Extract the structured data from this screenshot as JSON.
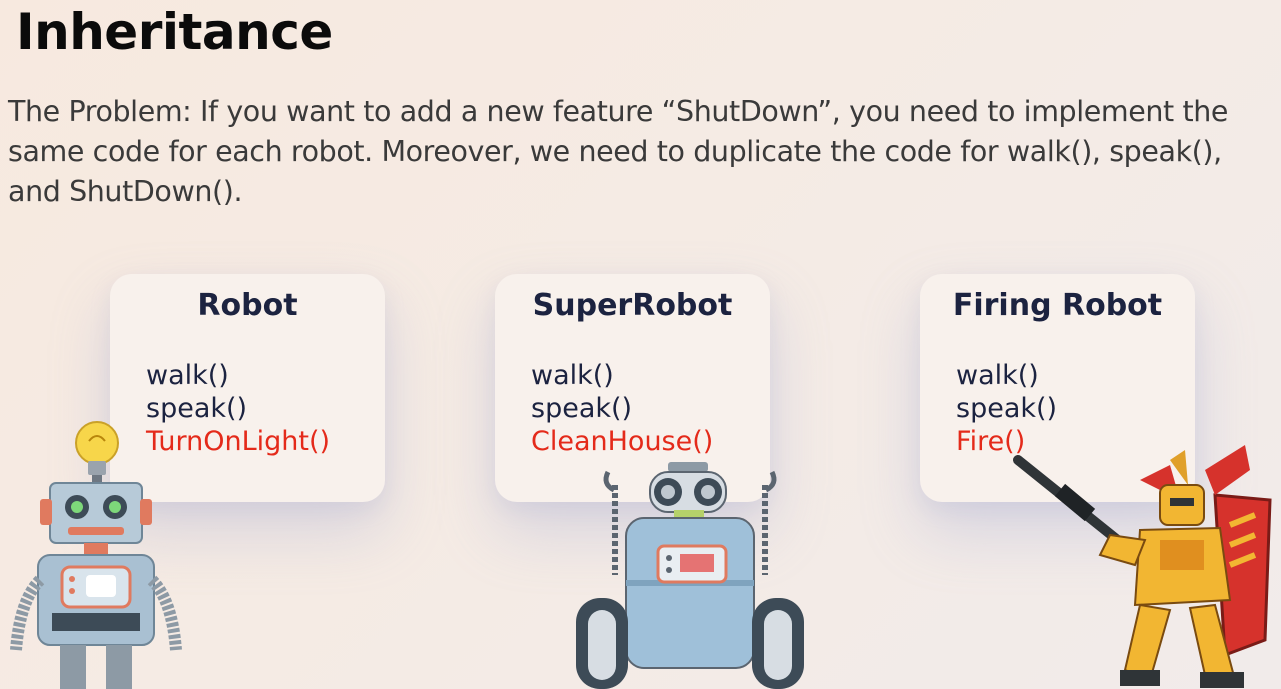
{
  "slide": {
    "title": "Inheritance",
    "problem_text": "The Problem: If you want to add a new feature “ShutDown”, you need to implement the same code for each robot. Moreover, we need to duplicate the code for walk(), speak(), and ShutDown()."
  },
  "cards": [
    {
      "title": "Robot",
      "methods": [
        "walk()",
        "speak()"
      ],
      "special": "TurnOnLight()"
    },
    {
      "title": "SuperRobot",
      "methods": [
        "walk()",
        "speak()"
      ],
      "special": "CleanHouse()"
    },
    {
      "title": "Firing Robot",
      "methods": [
        "walk()",
        "speak()"
      ],
      "special": "Fire()"
    }
  ],
  "colors": {
    "title": "#0b0b0b",
    "method_text": "#1c2340",
    "special_method": "#e42a1a",
    "card_bg": "#f8f1ec"
  },
  "illustrations": [
    "lightbulb-robot-illustration",
    "wheeled-robot-illustration",
    "mech-gunner-robot-illustration"
  ]
}
